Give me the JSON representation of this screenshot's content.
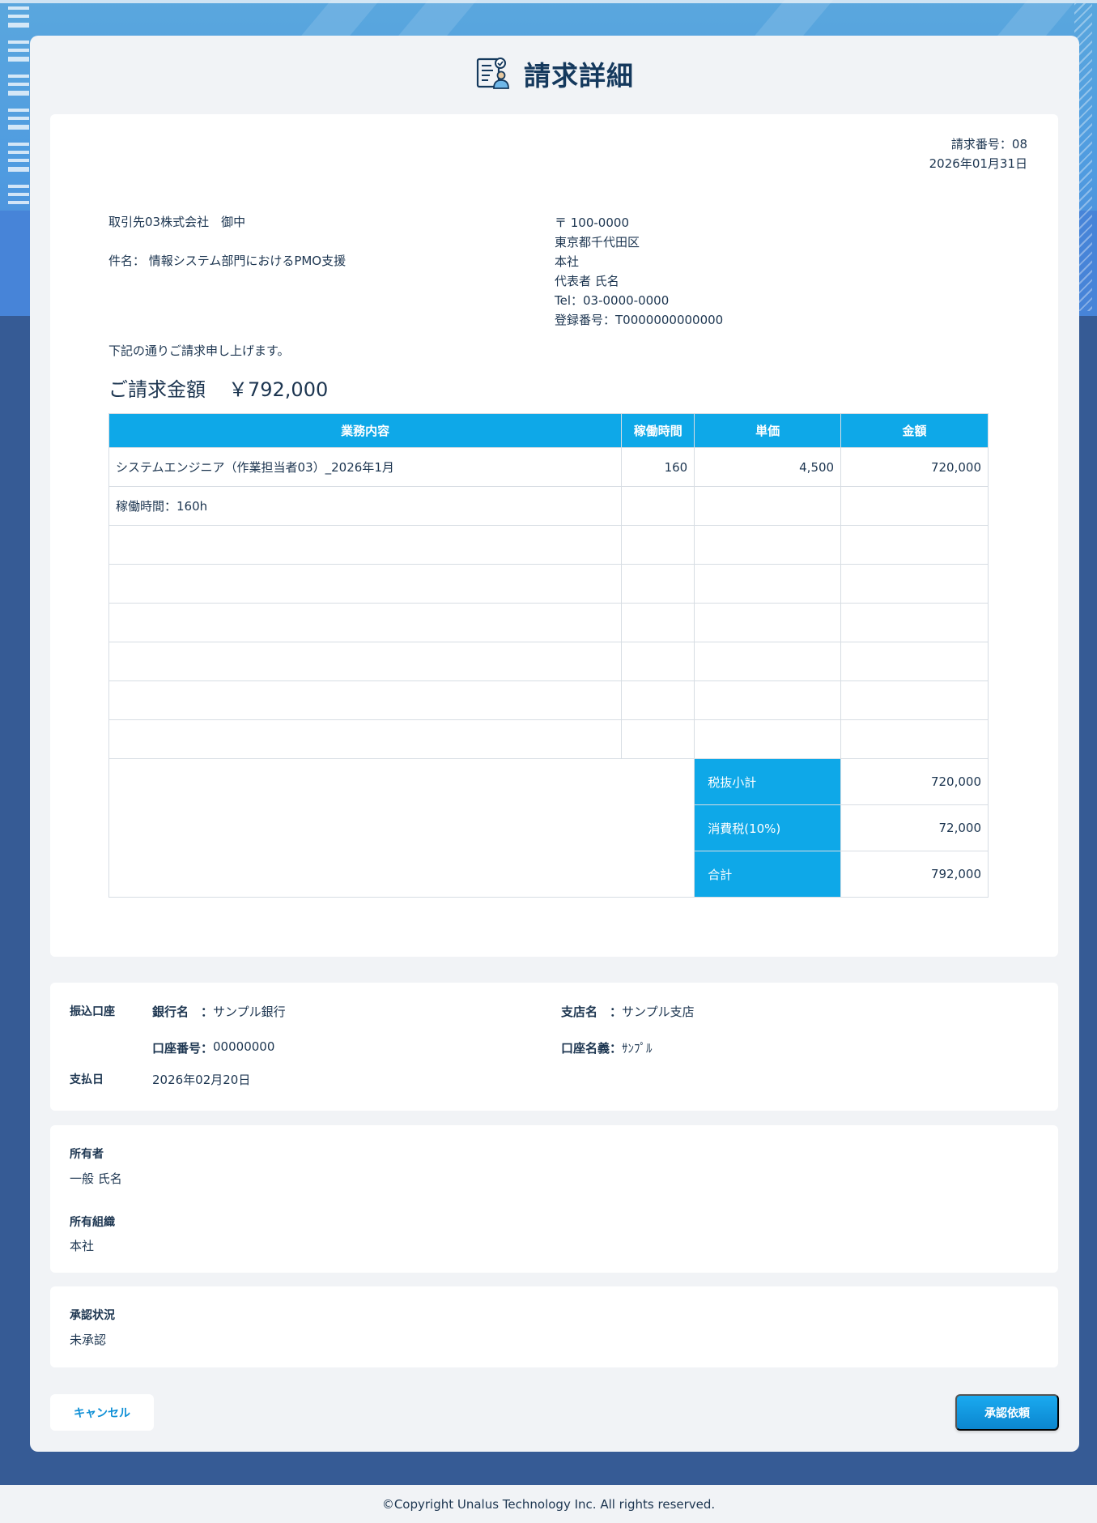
{
  "page": {
    "title": "請求詳細",
    "title_icon": "invoice-document-icon"
  },
  "invoice": {
    "number_label": "請求番号：08",
    "date": "2026年01月31日",
    "client": "取引先03株式会社　御中",
    "subject": "件名：  情報システム部門におけるPMO支援",
    "issuer": {
      "postal": "〒 100-0000",
      "address": "東京都千代田区",
      "office": "本社",
      "representative": "代表者 氏名",
      "tel": "Tel：03-0000-0000",
      "registration": "登録番号：T0000000000000"
    },
    "note": "下記の通りご請求申し上げます。",
    "amount_label": "ご請求金額",
    "amount_value": "￥792,000",
    "table": {
      "headers": [
        "業務内容",
        "稼働時間",
        "単価",
        "金額"
      ],
      "rows": [
        [
          "システムエンジニア（作業担当者03）_2026年1月",
          "160",
          "4,500",
          "720,000"
        ],
        [
          "稼働時間：160h",
          "",
          "",
          ""
        ],
        [
          "",
          "",
          "",
          ""
        ],
        [
          "",
          "",
          "",
          ""
        ],
        [
          "",
          "",
          "",
          ""
        ],
        [
          "",
          "",
          "",
          ""
        ],
        [
          "",
          "",
          "",
          ""
        ],
        [
          "",
          "",
          "",
          ""
        ]
      ],
      "summary": [
        {
          "label": "税抜小計",
          "value": "720,000"
        },
        {
          "label": "消費税(10%)",
          "value": "72,000"
        },
        {
          "label": "合計",
          "value": "792,000"
        }
      ]
    }
  },
  "bank": {
    "section_label": "振込口座",
    "bank_name_key": "銀行名　：",
    "bank_name": "サンプル銀行",
    "branch_key": "支店名　：",
    "branch": "サンプル支店",
    "account_no_key": "口座番号：",
    "account_no": "00000000",
    "account_name_key": "口座名義：",
    "account_name": "ｻﾝﾌﾟﾙ",
    "pay_date_label": "支払日",
    "pay_date": "2026年02月20日"
  },
  "owner": {
    "owner_label": "所有者",
    "owner_value": "一般 氏名",
    "org_label": "所有組織",
    "org_value": "本社"
  },
  "approval": {
    "label": "承認状況",
    "value": "未承認"
  },
  "buttons": {
    "cancel": "キャンセル",
    "request": "承認依頼"
  },
  "footer": {
    "copyright": "©Copyright Unalus Technology Inc. All rights reserved."
  },
  "colors": {
    "accent": "#0ea8e8",
    "title": "#15395d",
    "background": "#365b95"
  }
}
